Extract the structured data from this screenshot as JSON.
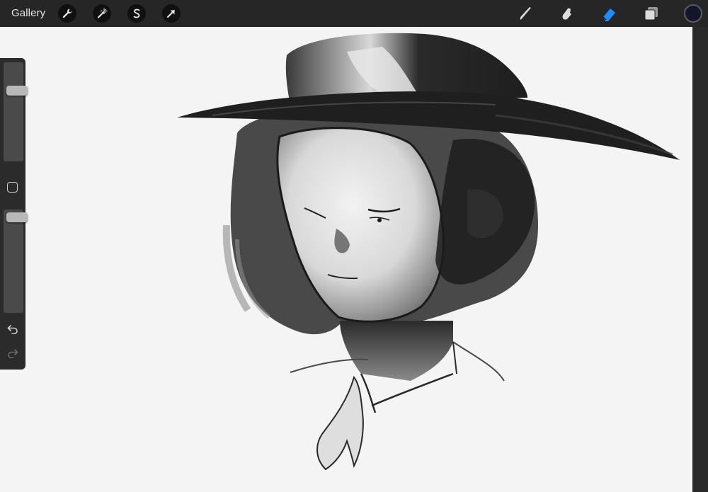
{
  "topbar": {
    "gallery_label": "Gallery",
    "left_tools": [
      {
        "icon": "wrench-icon",
        "name": "actions"
      },
      {
        "icon": "magic-wand-icon",
        "name": "adjustments"
      },
      {
        "icon": "selection-s-icon",
        "name": "selection"
      },
      {
        "icon": "arrow-cursor-icon",
        "name": "transform"
      }
    ],
    "right_tools": [
      {
        "icon": "brush-icon",
        "name": "paint"
      },
      {
        "icon": "smudge-icon",
        "name": "smudge"
      },
      {
        "icon": "eraser-icon",
        "name": "erase",
        "active": true
      },
      {
        "icon": "layers-icon",
        "name": "layers"
      }
    ],
    "active_color": "#15152a",
    "accent_color": "#1f8bff"
  },
  "sidebar": {
    "brush_size_level": 0.74,
    "opacity_level": 0.97
  }
}
